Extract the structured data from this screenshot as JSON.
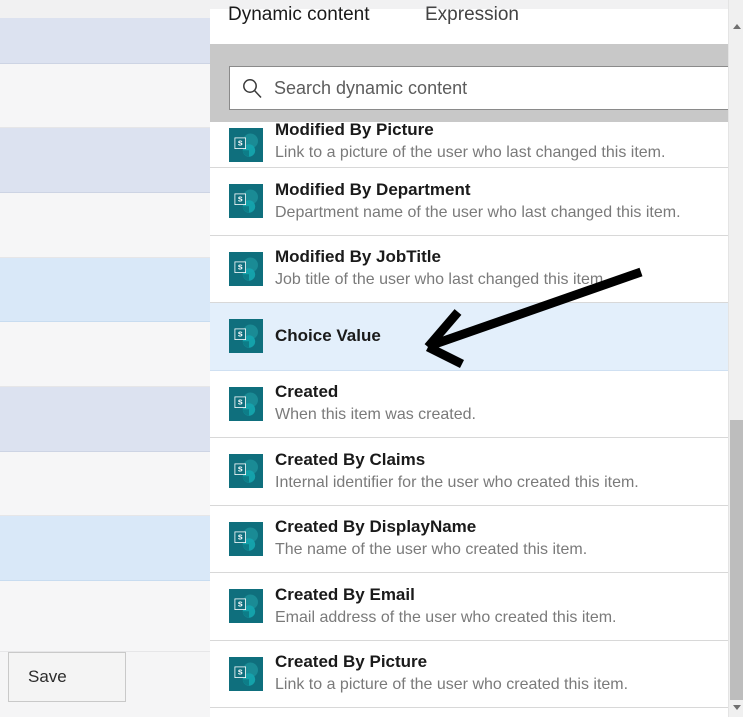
{
  "panel": {
    "tabs": [
      {
        "label": "Dynamic content",
        "selected": true
      },
      {
        "label": "Expression",
        "selected": false
      }
    ],
    "accent_color": "#1268cd",
    "search": {
      "placeholder": "Search dynamic content",
      "value": "",
      "icon": "search-icon"
    }
  },
  "left_form": {
    "save_label": "Save"
  },
  "dynamic_content": {
    "icon_name": "sharepoint-icon",
    "items": [
      {
        "title": "Modified By Picture",
        "description": "Link to a picture of the user who last changed this item.",
        "selected": false,
        "clipped": true
      },
      {
        "title": "Modified By Department",
        "description": "Department name of the user who last changed this item.",
        "selected": false,
        "clipped": false
      },
      {
        "title": "Modified By JobTitle",
        "description": "Job title of the user who last changed this item.",
        "selected": false,
        "clipped": false
      },
      {
        "title": "Choice Value",
        "description": "",
        "selected": true,
        "clipped": false
      },
      {
        "title": "Created",
        "description": "When this item was created.",
        "selected": false,
        "clipped": false
      },
      {
        "title": "Created By Claims",
        "description": "Internal identifier for the user who created this item.",
        "selected": false,
        "clipped": false
      },
      {
        "title": "Created By DisplayName",
        "description": "The name of the user who created this item.",
        "selected": false,
        "clipped": false
      },
      {
        "title": "Created By Email",
        "description": "Email address of the user who created this item.",
        "selected": false,
        "clipped": false
      },
      {
        "title": "Created By Picture",
        "description": "Link to a picture of the user who created this item.",
        "selected": false,
        "clipped": false
      }
    ]
  },
  "annotation": {
    "type": "arrow",
    "points_to": "Choice Value",
    "color": "#000000"
  },
  "scrollbar": {
    "up_icon": "scroll-up-arrow-icon",
    "down_icon": "scroll-down-arrow-icon",
    "thumb": "scroll-thumb"
  }
}
